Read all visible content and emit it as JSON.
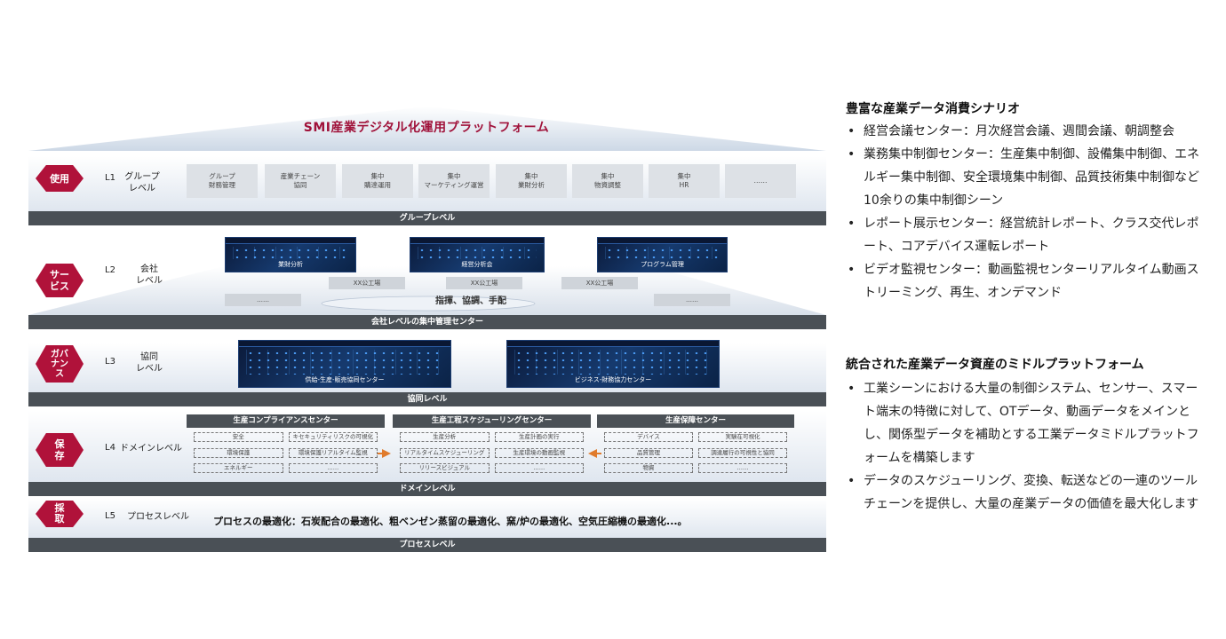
{
  "title": "SMI産業デジタル化運用プラットフォーム",
  "layers": {
    "l1": {
      "badge": "使用",
      "level": "L1",
      "name": "グループ\nレベル",
      "bar": "グループレベル",
      "boxes": [
        "グループ\n財務管理",
        "産業チェーン\n協同",
        "集中\n購達運用",
        "集中\nマーケティング運営",
        "集中\n業財分析",
        "集中\n物資調整",
        "集中\nHR",
        "……"
      ]
    },
    "l2": {
      "badge": "サー\nビス",
      "level": "L2",
      "name": "会社\nレベル",
      "bar": "会社レベルの集中管理センター",
      "screens": [
        "業財分析",
        "経営分析会",
        "プログラム管理"
      ],
      "tags": [
        "XX公工場",
        "XX公工場",
        "XX公工場"
      ],
      "side_tags": [
        "……",
        "……"
      ],
      "footer": "指揮、協調、手配"
    },
    "l3": {
      "badge": "ガバ\nナン\nス",
      "level": "L3",
      "name": "協同\nレベル",
      "bar": "協同レベル",
      "screens": [
        "供給-生産-販売協同センター",
        "ビジネス-財務協力センター"
      ]
    },
    "l4": {
      "badge": "保\n存",
      "level": "L4",
      "name": "ドメインレベル",
      "bar": "ドメインレベル",
      "centers": [
        {
          "title": "生産コンプライアンスセンター",
          "cells": [
            "安全",
            "キセキュリティリスクの可視化",
            "環境保護",
            "環境保護リアルタイム監視",
            "エネルギー",
            "……"
          ]
        },
        {
          "title": "生産工程スケジューリングセンター",
          "cells": [
            "生産分析",
            "生産計画の実行",
            "リアルタイムスケジューリング",
            "生産環境の動画監視",
            "リリースビジュアル",
            "……"
          ]
        },
        {
          "title": "生産保障センター",
          "cells": [
            "デバイス",
            "実験在可視化",
            "品質管理",
            "調達履行の可視性と協同",
            "物資",
            "……"
          ]
        }
      ]
    },
    "l5": {
      "badge": "採\n取",
      "level": "L5",
      "name": "プロセスレベル",
      "bar": "プロセスレベル",
      "text": "プロセスの最適化：石炭配合の最適化、粗ベンゼン蒸留の最適化、窯/炉の最適化、空気圧縮機の最適化...。"
    }
  },
  "right": {
    "section1": {
      "title": "豊富な産業データ消費シナリオ",
      "items": [
        "経営会議センター：月次経営会議、週間会議、朝調整会",
        "業務集中制御センター：生産集中制御、設備集中制御、エネルギー集中制御、安全環境集中制御、品質技術集中制御など10余りの集中制御シーン",
        "レポート展示センター：経営統計レポート、クラス交代レポート、コアデバイス運転レポート",
        "ビデオ監視センター：動画監視センターリアルタイム動画ストリーミング、再生、オンデマンド"
      ]
    },
    "section2": {
      "title": "統合された産業データ資産のミドルプラットフォーム",
      "items": [
        "工業シーンにおける大量の制御システム、センサー、スマート端末の特徴に対して、OTデータ、動画データをメインとし、関係型データを補助とする工業データミドルプラットフォームを構築します",
        "データのスケジューリング、変換、転送などの一連のツールチェーンを提供し、大量の産業データの価値を最大化します"
      ]
    }
  },
  "colors": {
    "accent": "#b0123a",
    "bar": "#4a5056"
  }
}
